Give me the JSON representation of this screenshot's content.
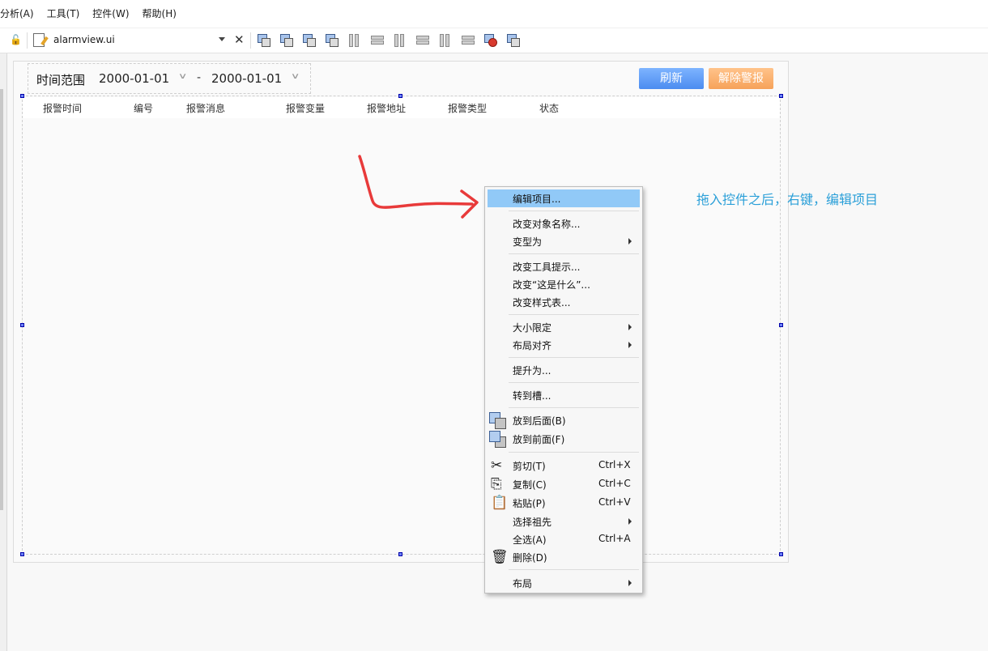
{
  "menubar": {
    "items": [
      "分析(A)",
      "工具(T)",
      "控件(W)",
      "帮助(H)"
    ]
  },
  "toolbar": {
    "file_name": "alarmview.ui",
    "tools": [
      "edit-widgets",
      "edit-signals-slots",
      "edit-buddies",
      "edit-tab-order",
      "lay-out-horizontally",
      "lay-out-vertically",
      "lay-out-horizontal-splitter",
      "lay-out-vertical-splitter",
      "lay-out-form",
      "lay-out-grid",
      "break-layout",
      "adjust-size"
    ]
  },
  "form": {
    "time_range_label": "时间范围",
    "date_start": "2000-01-01",
    "date_sep": "-",
    "date_end": "2000-01-01",
    "refresh_label": "刷新",
    "clear_alarm_label": "解除警报",
    "columns": [
      "报警时间",
      "编号",
      "报警消息",
      "报警变量",
      "报警地址",
      "报警类型",
      "状态"
    ]
  },
  "annotation": {
    "text": "拖入控件之后，右键，编辑项目",
    "color": "#2a9fd8"
  },
  "context_menu": {
    "items": [
      {
        "label": "编辑项目...",
        "highlighted": true
      },
      {
        "label": "改变对象名称..."
      },
      {
        "label": "变型为",
        "submenu": true
      },
      {
        "label": "改变工具提示..."
      },
      {
        "label": "改变“这是什么”..."
      },
      {
        "label": "改变样式表..."
      },
      {
        "label": "大小限定",
        "submenu": true
      },
      {
        "label": "布局对齐",
        "submenu": true
      },
      {
        "label": "提升为..."
      },
      {
        "label": "转到槽..."
      },
      {
        "label": "放到后面(B)",
        "icon": "send-to-back-icon"
      },
      {
        "label": "放到前面(F)",
        "icon": "bring-to-front-icon"
      },
      {
        "label": "剪切(T)",
        "shortcut": "Ctrl+X",
        "icon": "scissors-icon"
      },
      {
        "label": "复制(C)",
        "shortcut": "Ctrl+C",
        "icon": "copy-icon"
      },
      {
        "label": "粘贴(P)",
        "shortcut": "Ctrl+V",
        "icon": "paste-icon"
      },
      {
        "label": "选择祖先",
        "submenu": true
      },
      {
        "label": "全选(A)",
        "shortcut": "Ctrl+A"
      },
      {
        "label": "删除(D)",
        "icon": "trash-icon"
      },
      {
        "label": "布局",
        "submenu": true
      }
    ]
  },
  "colors": {
    "highlight": "#91c9f7",
    "refresh_button": "#5c9af5",
    "clear_button": "#f6a25a",
    "arrow": "#e83a3a"
  }
}
